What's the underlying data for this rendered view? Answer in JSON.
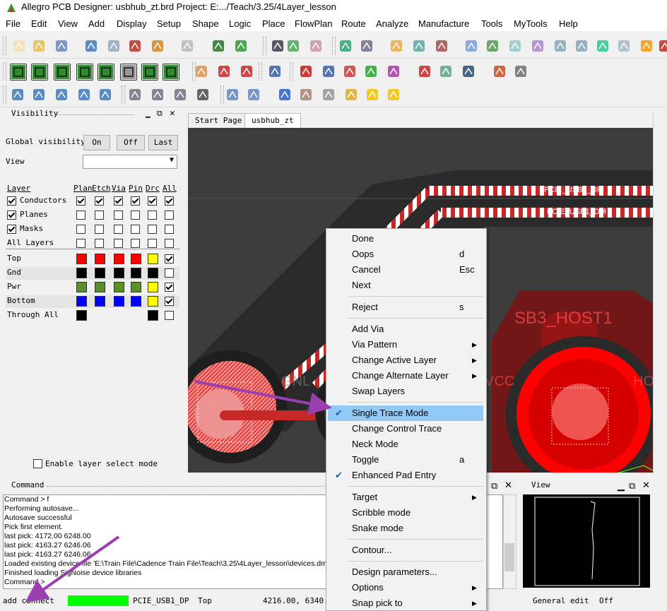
{
  "title": "Allegro PCB Designer: usbhub_zt.brd  Project: E:.../Teach/3.25/4Layer_lesson",
  "menu": [
    "File",
    "Edit",
    "View",
    "Add",
    "Display",
    "Setup",
    "Shape",
    "Logic",
    "Place",
    "FlowPlan",
    "Route",
    "Analyze",
    "Manufacture",
    "Tools",
    "MyTools",
    "Help"
  ],
  "visibility": {
    "title": "Visibility",
    "global_label": "Global visibility",
    "on": "On",
    "off": "Off",
    "last": "Last",
    "view_label": "View",
    "headers": [
      "Layer",
      "Plan",
      "Etch",
      "Via",
      "Pin",
      "Drc",
      "All"
    ],
    "groups": [
      {
        "label": "Conductors",
        "checked": true,
        "boxes": [
          true,
          true,
          true,
          true,
          true,
          true
        ]
      },
      {
        "label": "Planes",
        "checked": true,
        "boxes": [
          false,
          false,
          false,
          false,
          false,
          false
        ]
      },
      {
        "label": "Masks",
        "checked": true,
        "boxes": [
          false,
          false,
          false,
          false,
          false,
          false
        ]
      },
      {
        "label": "All Layers",
        "checked": false,
        "boxes": [
          false,
          false,
          false,
          false,
          false,
          false
        ]
      }
    ],
    "layers": [
      {
        "label": "Top",
        "colors": [
          "#ff0000",
          "#ff0000",
          "#ff0000",
          "#ff0000",
          "#ffff00"
        ],
        "all": true
      },
      {
        "label": "Gnd",
        "colors": [
          "#000000",
          "#000000",
          "#000000",
          "#000000",
          "#000000"
        ],
        "all": false
      },
      {
        "label": "Pwr",
        "colors": [
          "#5a8f29",
          "#5a8f29",
          "#5a8f29",
          "#5a8f29",
          "#ffff00"
        ],
        "all": true
      },
      {
        "label": "Bottom",
        "colors": [
          "#0000ff",
          "#0000ff",
          "#0000ff",
          "#0000ff",
          "#ffff00"
        ],
        "all": true
      },
      {
        "label": "Through All",
        "colors": [
          "#000000",
          null,
          null,
          null,
          "#000000"
        ],
        "all": false
      }
    ],
    "enable_select": "Enable layer select mode"
  },
  "tabs": [
    "Start Page",
    "usbhub_zt"
  ],
  "canvas_labels": {
    "dp": "PCIE_USB1_DP",
    "dm": "PCIE_USB1_DM",
    "host": "SB3_HOST1",
    "gnd": "GNL",
    "vcc": "VCC",
    "ho": "HO"
  },
  "command": {
    "title": "Command",
    "lines": [
      "Command > f",
      "Performing autosave...",
      "Autosave successful",
      "Pick first element.",
      "last pick:  4172.00 6248.00",
      "last pick:  4163.27 6246.06",
      "last pick:  4163.27 6246.06",
      "Loaded existing device file 'E:\\Train File\\Cadence Train File\\Teach\\3.25\\4Layer_lesson\\devices.dml'.",
      "Finished loading SigNoise device libraries",
      "Command >"
    ]
  },
  "view_panel_title": "View",
  "context_menu": [
    {
      "label": "Done"
    },
    {
      "label": "Oops",
      "shortcut": "d"
    },
    {
      "label": "Cancel",
      "shortcut": "Esc"
    },
    {
      "label": "Next"
    },
    {
      "sep": true
    },
    {
      "label": "Reject",
      "shortcut": "s"
    },
    {
      "sep": true
    },
    {
      "label": "Add Via"
    },
    {
      "label": "Via Pattern",
      "submenu": true
    },
    {
      "label": "Change Active Layer",
      "submenu": true
    },
    {
      "label": "Change Alternate Layer",
      "submenu": true
    },
    {
      "label": "Swap Layers"
    },
    {
      "sep": true
    },
    {
      "label": "Single Trace Mode",
      "checked": true,
      "highlight": true
    },
    {
      "label": "Change Control Trace"
    },
    {
      "label": "Neck Mode"
    },
    {
      "label": "Toggle",
      "shortcut": "a"
    },
    {
      "label": "Enhanced Pad Entry",
      "checked": true
    },
    {
      "sep": true
    },
    {
      "label": "Target",
      "submenu": true
    },
    {
      "label": "Scribble mode"
    },
    {
      "label": "Snake mode"
    },
    {
      "sep": true
    },
    {
      "label": "Contour..."
    },
    {
      "sep": true
    },
    {
      "label": "Design parameters..."
    },
    {
      "label": "Options",
      "submenu": true
    },
    {
      "label": "Snap pick to",
      "submenu": true
    }
  ],
  "status": {
    "cmd": "add connect",
    "net": "PCIE_USB1_DP",
    "layer": "Top",
    "coords": "4216.00, 6340.0",
    "mode": "General edit",
    "state": "Off",
    "status_color": "#00ff00"
  }
}
